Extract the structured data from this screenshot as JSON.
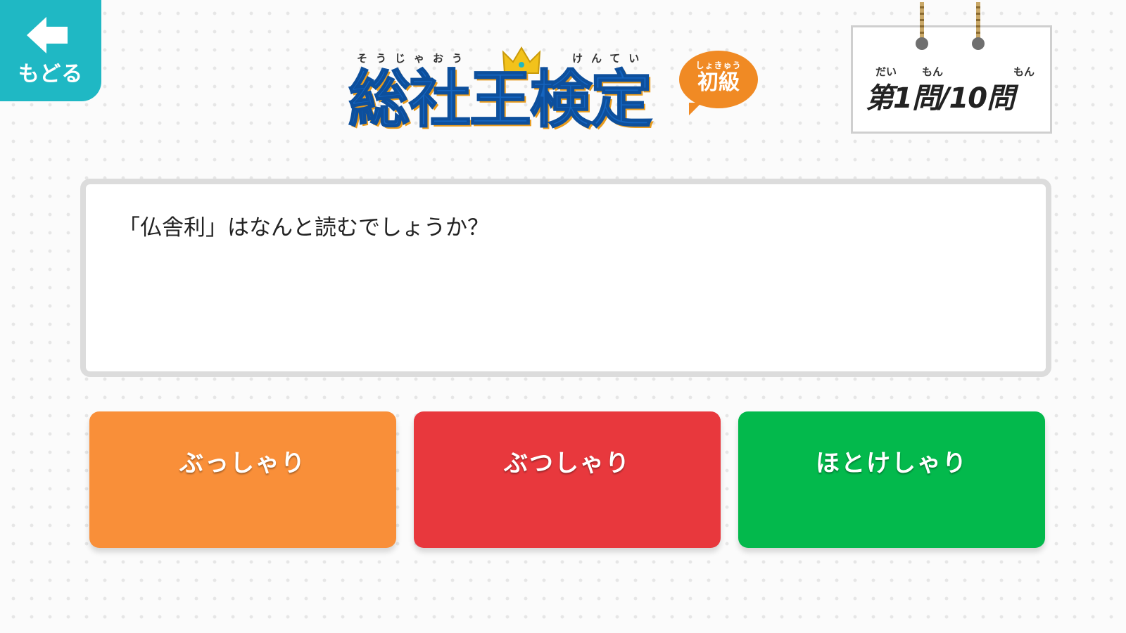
{
  "back_button": {
    "label": "もどる",
    "icon": "arrow-left-icon"
  },
  "logo": {
    "ruby_left": "そうじゃおう",
    "ruby_right": "けんてい",
    "title": "総社王検定",
    "level_ruby": "しょきゅう",
    "level": "初級",
    "icon": "crown-icon"
  },
  "counter": {
    "furigana_1": "だい",
    "furigana_2": "もん",
    "furigana_3": "もん",
    "text": "第1問/10問",
    "current": 1,
    "total": 10
  },
  "question": {
    "text": "「仏舎利」はなんと読むでしょうか？"
  },
  "answers": [
    {
      "label": "ぶっしゃり",
      "color": "#f98f39"
    },
    {
      "label": "ぶつしゃり",
      "color": "#e8383d"
    },
    {
      "label": "ほとけしゃり",
      "color": "#03b94c"
    }
  ],
  "colors": {
    "back_button": "#1fb8c4",
    "logo_blue": "#1565c0",
    "logo_orange": "#f08a24"
  }
}
